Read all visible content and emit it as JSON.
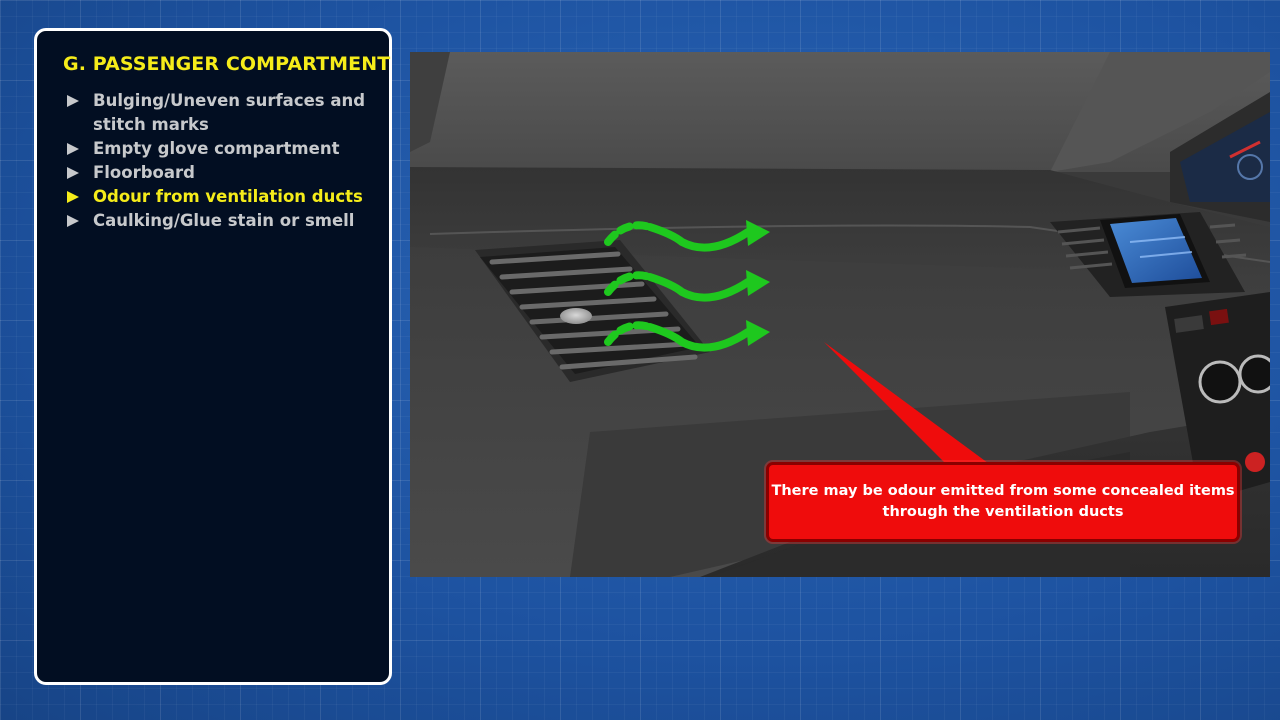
{
  "panel": {
    "title": "G. PASSENGER COMPARTMENT",
    "items": [
      {
        "label": "Bulging/Uneven surfaces and stitch marks",
        "active": false
      },
      {
        "label": "Empty glove compartment",
        "active": false
      },
      {
        "label": "Floorboard",
        "active": false
      },
      {
        "label": "Odour from ventilation ducts",
        "active": true
      },
      {
        "label": "Caulking/Glue stain or smell",
        "active": false
      }
    ]
  },
  "scene": {
    "subject": "car dashboard interior",
    "icon": "airflow-arrows-icon"
  },
  "callout": {
    "text": "There may be odour emitted from some concealed items through the ventilation ducts"
  },
  "colors": {
    "accent_yellow": "#f5ec1a",
    "callout_red": "#ef0c0c",
    "airflow_green": "#1ec81e",
    "panel_bg": "#020e22",
    "page_bg": "#1f57a6"
  }
}
